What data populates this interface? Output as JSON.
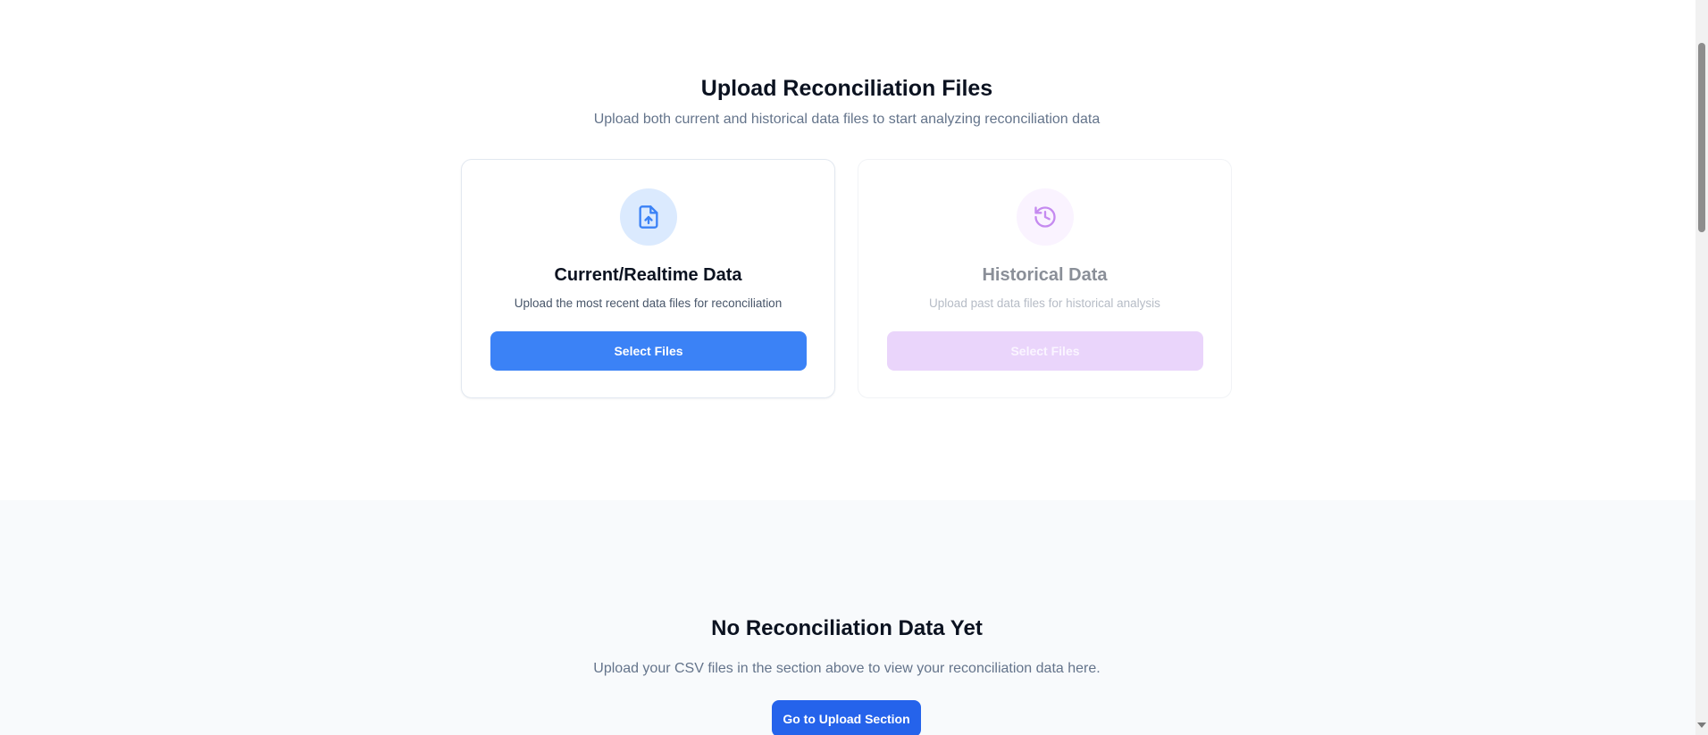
{
  "upload_section": {
    "title": "Upload Reconciliation Files",
    "subtitle": "Upload both current and historical data files to start analyzing reconciliation data",
    "cards": [
      {
        "id": "current",
        "icon": "file-upload-icon",
        "title": "Current/Realtime Data",
        "description": "Upload the most recent data files for reconciliation",
        "button_label": "Select Files",
        "state": "enabled",
        "accent_color": "#3b82f6"
      },
      {
        "id": "historical",
        "icon": "history-icon",
        "title": "Historical Data",
        "description": "Upload past data files for historical analysis",
        "button_label": "Select Files",
        "state": "disabled",
        "accent_color": "#a855f7"
      }
    ]
  },
  "empty_state": {
    "title": "No Reconciliation Data Yet",
    "description": "Upload your CSV files in the section above to view your reconciliation data here.",
    "button_label": "Go to Upload Section",
    "button_color": "#2563eb"
  }
}
